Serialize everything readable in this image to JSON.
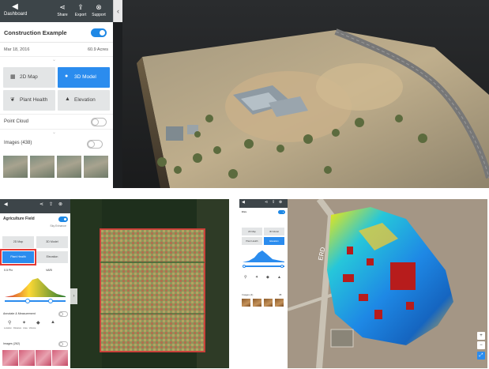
{
  "top_panel": {
    "toolbar": {
      "back_label": "Dashboard",
      "actions": [
        {
          "label": "Share",
          "icon": "share-icon"
        },
        {
          "label": "Export",
          "icon": "export-icon"
        },
        {
          "label": "Support",
          "icon": "support-icon"
        }
      ]
    },
    "project": {
      "title": "Construction Example",
      "toggle_on": true,
      "date": "Mar 18, 2016",
      "acres": "60.9 Acres"
    },
    "views": [
      {
        "label": "2D Map",
        "icon": "map-icon",
        "active": false
      },
      {
        "label": "3D Model",
        "icon": "cube-icon",
        "active": true
      },
      {
        "label": "Plant Health",
        "icon": "leaf-icon",
        "active": false
      },
      {
        "label": "Elevation",
        "icon": "mountain-icon",
        "active": false
      }
    ],
    "point_cloud": {
      "label": "Point Cloud",
      "on": false
    },
    "images": {
      "label": "Images (438)",
      "on": false
    },
    "collapse_glyph": "‹"
  },
  "bottom_left": {
    "title": "Agriculture Field",
    "subtitle": "Sky Enhance",
    "views": [
      {
        "label": "2D Map",
        "active": false
      },
      {
        "label": "3D Model",
        "active": false
      },
      {
        "label": "Plant Health",
        "active": true
      },
      {
        "label": "Elevation",
        "active": false
      }
    ],
    "index_left": "0.5 Pix",
    "index_right": "VARI",
    "annotations_label": "Annotate & Measurement",
    "tools": [
      "Location",
      "Distance",
      "Area",
      "Volume"
    ],
    "images_label": "Images (262)"
  },
  "bottom_right": {
    "title": "Elev",
    "views": [
      "2D Map",
      "3D Model",
      "Plant Health",
      "Elevation"
    ],
    "images_label": "Images (4)",
    "images_count": "38",
    "road_label": "ERD",
    "controls": [
      "+",
      "−",
      "⤢"
    ]
  },
  "colors": {
    "toolbar": "#3d4549",
    "accent": "#2b8cee",
    "highlight": "#e53935"
  }
}
